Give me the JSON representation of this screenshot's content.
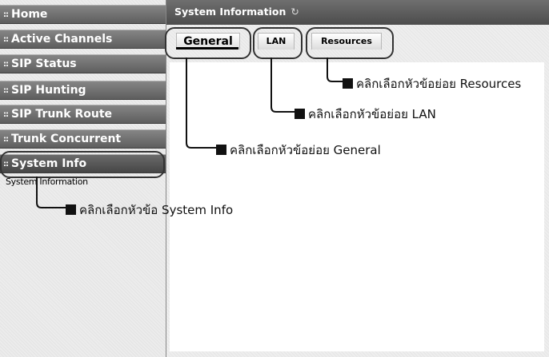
{
  "sidebar": {
    "items": [
      {
        "icon": "::",
        "label": "Home"
      },
      {
        "icon": "::",
        "label": "Active Channels"
      },
      {
        "icon": "::",
        "label": "SIP Status"
      },
      {
        "icon": "::",
        "label": "SIP Hunting"
      },
      {
        "icon": "::",
        "label": "SIP Trunk Route"
      },
      {
        "icon": "::",
        "label": "Trunk Concurrent"
      },
      {
        "icon": "::",
        "label": "System Info"
      }
    ],
    "submenu": {
      "label": "System Information"
    }
  },
  "header": {
    "title": "System Information",
    "refresh_icon": "refresh-icon"
  },
  "tabs": [
    {
      "label": "General"
    },
    {
      "label": "LAN"
    },
    {
      "label": "Resources"
    }
  ],
  "annotations": {
    "resources": "คลิกเลือกหัวข้อย่อย Resources",
    "lan": "คลิกเลือกหัวข้อย่อย LAN",
    "general": "คลิกเลือกหัวข้อย่อย General",
    "system_info": "คลิกเลือกหัวข้อ System Info"
  },
  "colors": {
    "sidebar_item": "#6e6e6e",
    "titlebar": "#5a5a5a",
    "annotation": "#111111"
  }
}
